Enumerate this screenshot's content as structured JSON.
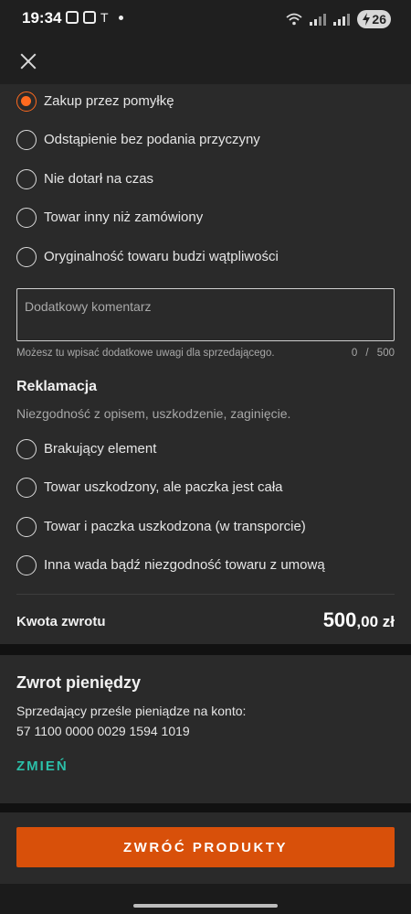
{
  "status_bar": {
    "time": "19:34",
    "battery": "26",
    "battery_icon": "bolt-icon"
  },
  "header": {
    "close_icon": "close-icon"
  },
  "return_reasons": {
    "selected": "Zakup przez pomyłkę",
    "items": [
      {
        "label": "Zakup przez pomyłkę",
        "selected": true
      },
      {
        "label": "Odstąpienie bez podania przyczyny",
        "selected": false
      },
      {
        "label": "Nie dotarł na czas",
        "selected": false
      },
      {
        "label": "Towar inny niż zamówiony",
        "selected": false
      },
      {
        "label": "Oryginalność towaru budzi wątpliwości",
        "selected": false
      }
    ]
  },
  "comment": {
    "placeholder": "Dodatkowy komentarz",
    "value": "",
    "helper": "Możesz tu wpisać dodatkowe uwagi dla sprzedającego.",
    "counter": "0 / 500"
  },
  "complaint": {
    "title": "Reklamacja",
    "subtitle": "Niezgodność z opisem, uszkodzenie, zaginięcie.",
    "items": [
      {
        "label": "Brakujący element",
        "selected": false
      },
      {
        "label": "Towar uszkodzony, ale paczka jest cała",
        "selected": false
      },
      {
        "label": "Towar i paczka uszkodzona (w transporcie)",
        "selected": false
      },
      {
        "label": "Inna wada bądź niezgodność towaru z umową",
        "selected": false
      }
    ]
  },
  "refund_amount": {
    "label": "Kwota zwrotu",
    "value_main": "500",
    "value_decimal": ",00 zł"
  },
  "money_refund": {
    "title": "Zwrot pieniędzy",
    "line1": "Sprzedający prześle pieniądze na konto:",
    "account": "57 1100 0000 0029 1594 1019",
    "change_label": "ZMIEŃ"
  },
  "action": {
    "button_label": "ZWRÓĆ PRODUKTY"
  },
  "colors": {
    "accent": "#d8500a",
    "radio_selected": "#ff6a1f",
    "link": "#2bbfa8",
    "card_bg": "#2a2a2a"
  }
}
